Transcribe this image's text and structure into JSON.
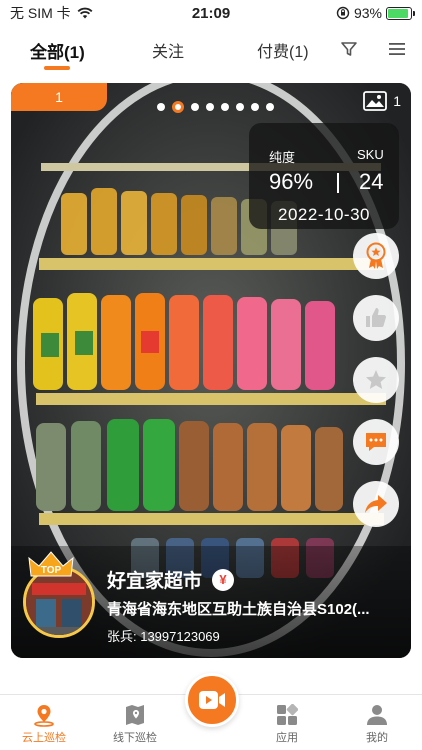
{
  "status_bar": {
    "carrier": "无 SIM 卡",
    "time": "21:09",
    "battery": "93%",
    "battery_level": 0.93
  },
  "tabs": [
    {
      "label": "全部(1)",
      "active": true
    },
    {
      "label": "关注",
      "active": false
    },
    {
      "label": "付费(1)",
      "active": false
    }
  ],
  "card": {
    "index": "1",
    "image_count": "1",
    "carousel_dots": 8,
    "carousel_active": 1,
    "stats": {
      "purity_label": "纯度",
      "purity_value": "96%",
      "sku_label": "SKU",
      "sku_value": "24",
      "date": "2022-10-30"
    },
    "store": {
      "badge": "TOP",
      "name": "好宜家超市",
      "paid_mark": "¥",
      "address": "青海省海东地区互助土族自治县S102(...",
      "contact": "张兵: 13997123069"
    }
  },
  "bottom_nav": [
    {
      "label": "云上巡检",
      "icon": "location-pin-icon",
      "active": true
    },
    {
      "label": "线下巡检",
      "icon": "map-icon",
      "active": false
    },
    {
      "label": "",
      "icon": "video-camera-icon",
      "active": false
    },
    {
      "label": "应用",
      "icon": "apps-grid-icon",
      "active": false
    },
    {
      "label": "我的",
      "icon": "user-icon",
      "active": false
    }
  ],
  "colors": {
    "accent": "#f47920",
    "danger": "#e94235",
    "gold": "#f7c948"
  }
}
